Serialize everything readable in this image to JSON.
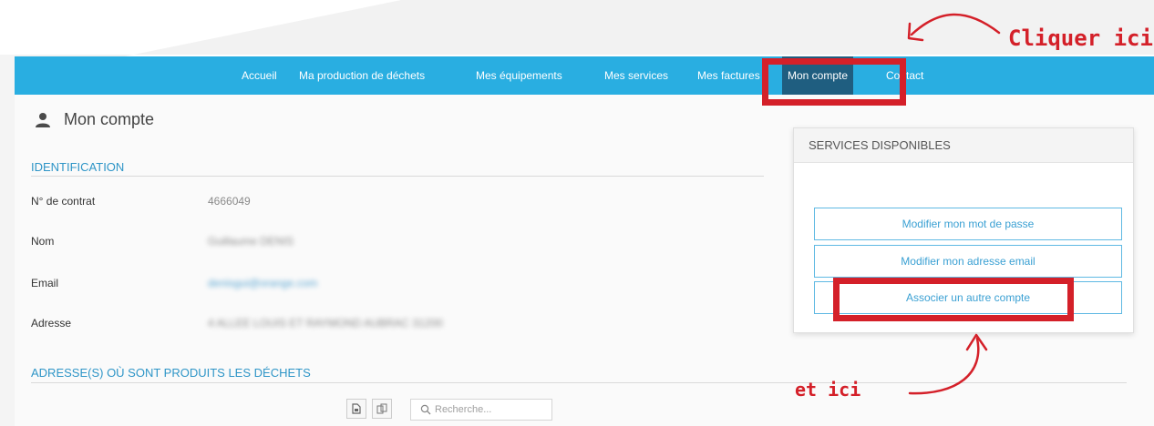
{
  "nav": {
    "items": [
      {
        "label": "Accueil"
      },
      {
        "label": "Ma production de déchets"
      },
      {
        "label": "Mes équipements"
      },
      {
        "label": "Mes services"
      },
      {
        "label": "Mes factures"
      },
      {
        "label": "Mon compte"
      },
      {
        "label": "Contact"
      }
    ],
    "active_index": 5
  },
  "page": {
    "title": "Mon compte",
    "icon": "user-icon"
  },
  "identification": {
    "title": "IDENTIFICATION",
    "fields": [
      {
        "label": "N° de contrat",
        "value": "4666049"
      },
      {
        "label": "Nom",
        "value": "Guillaume DENIS"
      },
      {
        "label": "Email",
        "value": "denisgui@orange.com"
      },
      {
        "label": "Adresse",
        "value": "4 ALLEE LOUIS ET RAYMOND AUBRAC 31200"
      }
    ]
  },
  "addresses": {
    "title": "ADRESSE(S) OÙ SONT PRODUITS LES DÉCHETS"
  },
  "search": {
    "placeholder": "Recherche..."
  },
  "services": {
    "title": "SERVICES DISPONIBLES",
    "buttons": [
      {
        "label": "Modifier mon mot de passe"
      },
      {
        "label": "Modifier mon adresse email"
      },
      {
        "label": "Associer un autre compte"
      }
    ]
  },
  "annotations": {
    "top": "Cliquer ici",
    "bottom": "et ici",
    "color": "#d42029"
  },
  "colors": {
    "navbar": "#29aee1",
    "nav_active": "#1f5e80",
    "accent": "#2e95c7"
  }
}
